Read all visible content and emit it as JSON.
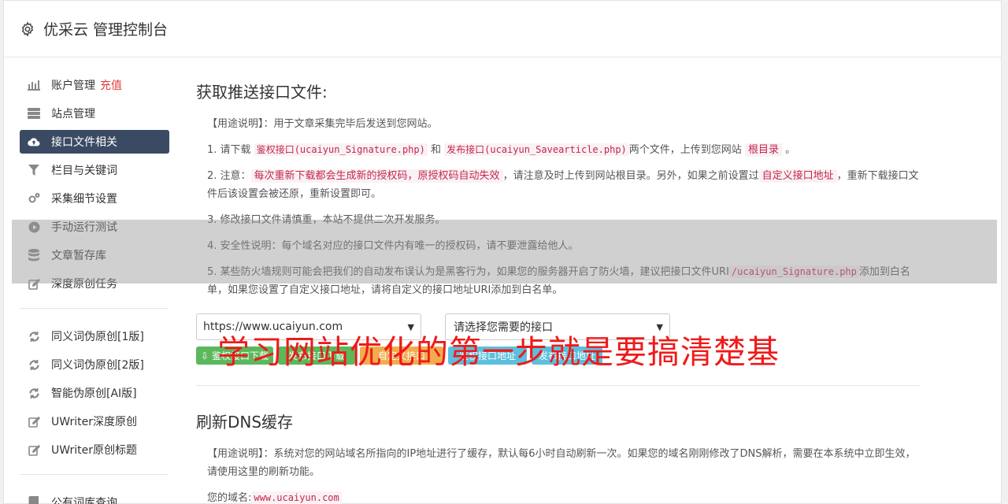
{
  "header": {
    "title": "优采云 管理控制台",
    "icon": "gear-icon"
  },
  "sidebar": {
    "items": [
      {
        "label": "账户管理",
        "badge": "充值",
        "icon": "bar-chart-icon"
      },
      {
        "label": "站点管理",
        "icon": "server-icon"
      },
      {
        "label": "接口文件相关",
        "icon": "cloud-upload-icon",
        "active": true
      },
      {
        "label": "栏目与关键词",
        "icon": "filter-icon"
      },
      {
        "label": "采集细节设置",
        "icon": "cogs-icon"
      },
      {
        "label": "手动运行测试",
        "icon": "play-icon"
      },
      {
        "label": "文章暂存库",
        "icon": "database-icon"
      },
      {
        "label": "深度原创任务",
        "icon": "edit-icon"
      }
    ],
    "items2": [
      {
        "label": "同义词伪原创[1版]",
        "icon": "refresh-icon"
      },
      {
        "label": "同义词伪原创[2版]",
        "icon": "refresh-icon"
      },
      {
        "label": "智能伪原创[AI版]",
        "icon": "refresh-icon"
      },
      {
        "label": "UWriter深度原创",
        "icon": "edit-icon"
      },
      {
        "label": "UWriter原创标题",
        "icon": "edit-icon"
      }
    ],
    "items3": [
      {
        "label": "公有词库查询",
        "icon": "book-icon"
      }
    ]
  },
  "section1": {
    "title": "获取推送接口文件:",
    "usage_label": "【用途说明】",
    "usage_text": "：用于文章采集完毕后发送到您网站。",
    "p1": {
      "a": "1. 请下载",
      "code1": "鉴权接口(ucaiyun_Signature.php)",
      "b": "和",
      "code2": "发布接口(ucaiyun_Savearticle.php)",
      "c": "两个文件，上传到您网站",
      "code3": "根目录",
      "d": "。"
    },
    "p2": {
      "a": "2. 注意：",
      "code1": "每次重新下载都会生成新的授权码，原授权码自动失效",
      "b": "，请注意及时上传到网站根目录。另外，如果之前设置过",
      "code2": "自定义接口地址",
      "c": "，重新下载接口文件后该设置会被还原，重新设置即可。"
    },
    "p3": "3. 修改接口文件请慎重，本站不提供二次开发服务。",
    "p4": "4. 安全性说明：每个域名对应的接口文件内有唯一的授权码，请不要泄露给他人。",
    "p5": {
      "a": "5. 某些防火墙规则可能会把我们的自动发布误认为是黑客行为，如果您的服务器开启了防火墙，建议把接口文件URI",
      "code1": "/ucaiyun_Signature.php",
      "b": "添加到白名单，如果您设置了自定义接口地址，请将自定义的接口地址URI添加到白名单。"
    },
    "select_site": "https://www.ucaiyun.com",
    "select_api": "请选择您需要的接口",
    "buttons": [
      "鉴权接口下载",
      "发布接口下载",
      "自定义接口",
      "鉴权接口地址",
      "发布接口地址"
    ]
  },
  "section2": {
    "title": "刷新DNS缓存",
    "usage_label": "【用途说明】",
    "usage_text": "：系统对您的网站域名所指向的IP地址进行了缓存，默认每6小时自动刷新一次。如果您的域名刚刚修改了DNS解析，需要在本系统中立即生效，请使用这里的刷新功能。",
    "domain_label": "您的域名:",
    "domain_value": "www.ucaiyun.com"
  },
  "watermark": "学习网站优化的第一步就是要搞清楚基",
  "colors": {
    "active_nav": "#3b4a63",
    "green": "#5cb85c",
    "orange": "#f0ad4e",
    "blue": "#5bc0de",
    "red": "#ef1a1a"
  }
}
